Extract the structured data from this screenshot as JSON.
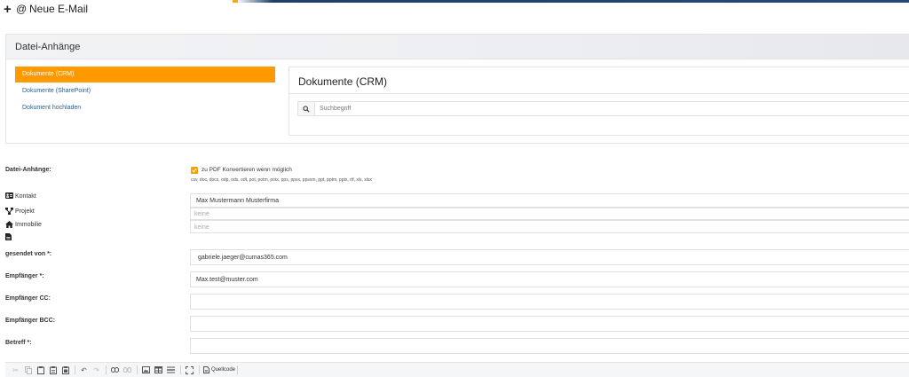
{
  "header": {
    "plus_glyph": "+",
    "at_glyph": "@",
    "title": "Neue E-Mail"
  },
  "attachments_panel": {
    "title": "Datei-Anhänge",
    "nav": [
      {
        "label": "Dokumente (CRM)",
        "active": true
      },
      {
        "label": "Dokumente (SharePoint)",
        "active": false
      },
      {
        "label": "Dokument hochladen",
        "active": false
      }
    ],
    "documents": {
      "title": "Dokumente (CRM)",
      "search_placeholder": "Suchbegriff"
    }
  },
  "form": {
    "attachments_label": "Datei-Anhänge:",
    "pdf_convert_label": "zu PDF Konvertieren wenn möglich",
    "pdf_convert_checked": true,
    "supported_formats": "csv, doc, docx, odp, ods, odt, pot, potm, potx, pps, ppsx, ppsxm, ppt, pptm, pptx, rtf, xls, xlsx",
    "relations": [
      {
        "icon": "contact-card-icon",
        "label": "Kontakt",
        "value": "Max Mustermann Musterfirma",
        "placeholder": ""
      },
      {
        "icon": "project-icon",
        "label": "Projekt",
        "value": "",
        "placeholder": "keine"
      },
      {
        "icon": "home-icon",
        "label": "Immobilie",
        "value": "",
        "placeholder": "keine"
      },
      {
        "icon": "document-icon",
        "label": "",
        "value": "",
        "placeholder": ""
      }
    ],
    "sent_from_label": "gesendet von *:",
    "sent_from_value": "gabriele.jaeger@cumas365.com",
    "to_label": "Empfänger *:",
    "to_value": "Max.test@muster.com",
    "cc_label": "Empfänger CC:",
    "cc_value": "",
    "bcc_label": "Empfänger BCC:",
    "bcc_value": "",
    "subject_label": "Betreff *:",
    "subject_value": ""
  },
  "editor_toolbar": {
    "source_label": "Quellcode"
  },
  "colors": {
    "accent": "#ff9900",
    "checkbox": "#f0a30a",
    "nav_link": "#2f5f8a",
    "top_bar": "#24497a"
  }
}
